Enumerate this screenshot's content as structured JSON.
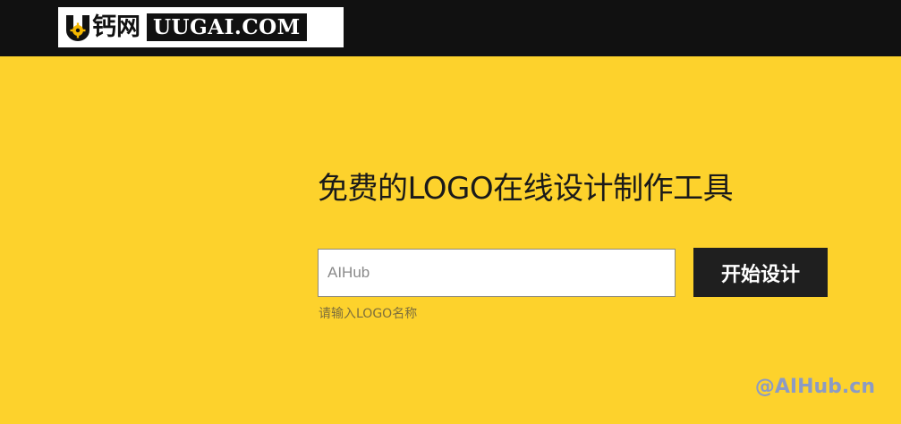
{
  "header": {
    "logo_cn": "钙网",
    "logo_en": "UUGAI.COM"
  },
  "main": {
    "headline": "免费的LOGO在线设计制作工具",
    "input_value": "AIHub",
    "input_placeholder": "AIHub",
    "button_label": "开始设计",
    "hint": "请输入LOGO名称"
  },
  "watermark": "@AIHub.cn",
  "colors": {
    "background": "#fdd22c",
    "topbar": "#111111",
    "button": "#1f1f1f"
  }
}
